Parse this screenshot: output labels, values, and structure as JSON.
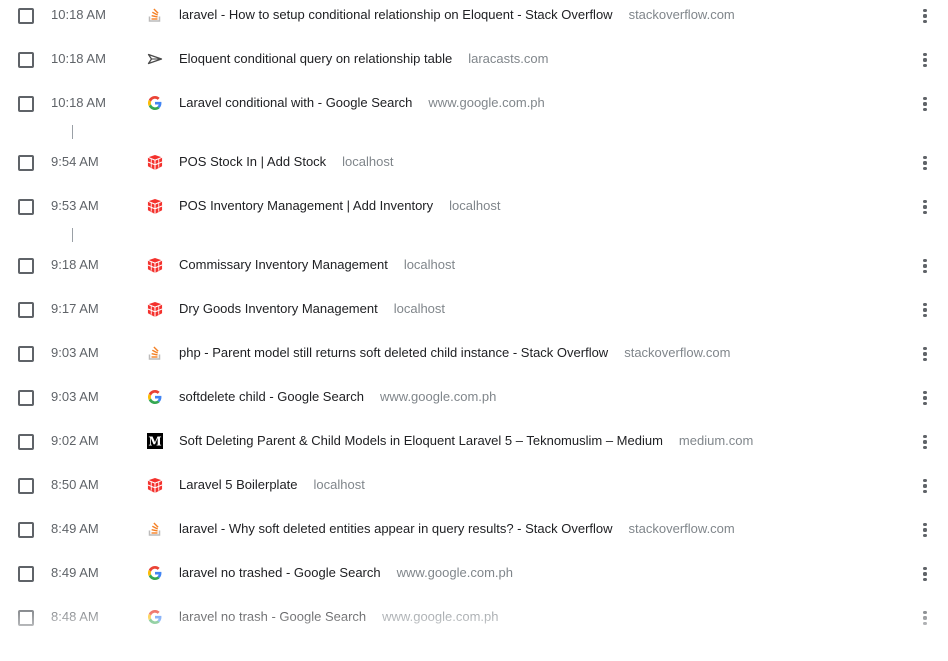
{
  "colors": {
    "text": "#202124",
    "muted": "#5f6368",
    "domain": "#80868b"
  },
  "entries": [
    {
      "time": "10:18 AM",
      "title": "laravel - How to setup conditional relationship on Eloquent - Stack Overflow",
      "domain": "stackoverflow.com",
      "icon": "stackoverflow-icon"
    },
    {
      "time": "10:18 AM",
      "title": "Eloquent conditional query on relationship table",
      "domain": "laracasts.com",
      "icon": "laracasts-icon"
    },
    {
      "time": "10:18 AM",
      "title": "Laravel conditional with - Google Search",
      "domain": "www.google.com.ph",
      "icon": "google-icon"
    },
    {
      "time": "9:54 AM",
      "title": "POS Stock In | Add Stock",
      "domain": "localhost",
      "icon": "laravel-icon"
    },
    {
      "time": "9:53 AM",
      "title": "POS Inventory Management | Add Inventory",
      "domain": "localhost",
      "icon": "laravel-icon"
    },
    {
      "time": "9:18 AM",
      "title": "Commissary Inventory Management",
      "domain": "localhost",
      "icon": "laravel-icon"
    },
    {
      "time": "9:17 AM",
      "title": "Dry Goods Inventory Management",
      "domain": "localhost",
      "icon": "laravel-icon"
    },
    {
      "time": "9:03 AM",
      "title": "php - Parent model still returns soft deleted child instance - Stack Overflow",
      "domain": "stackoverflow.com",
      "icon": "stackoverflow-icon"
    },
    {
      "time": "9:03 AM",
      "title": "softdelete child - Google Search",
      "domain": "www.google.com.ph",
      "icon": "google-icon"
    },
    {
      "time": "9:02 AM",
      "title": "Soft Deleting Parent & Child Models in Eloquent Laravel 5 – Teknomuslim – Medium",
      "domain": "medium.com",
      "icon": "medium-icon"
    },
    {
      "time": "8:50 AM",
      "title": "Laravel 5 Boilerplate",
      "domain": "localhost",
      "icon": "laravel-icon"
    },
    {
      "time": "8:49 AM",
      "title": "laravel - Why soft deleted entities appear in query results? - Stack Overflow",
      "domain": "stackoverflow.com",
      "icon": "stackoverflow-icon"
    },
    {
      "time": "8:49 AM",
      "title": "laravel no trashed - Google Search",
      "domain": "www.google.com.ph",
      "icon": "google-icon"
    },
    {
      "time": "8:48 AM",
      "title": "laravel no trash - Google Search",
      "domain": "www.google.com.ph",
      "icon": "google-icon"
    }
  ]
}
